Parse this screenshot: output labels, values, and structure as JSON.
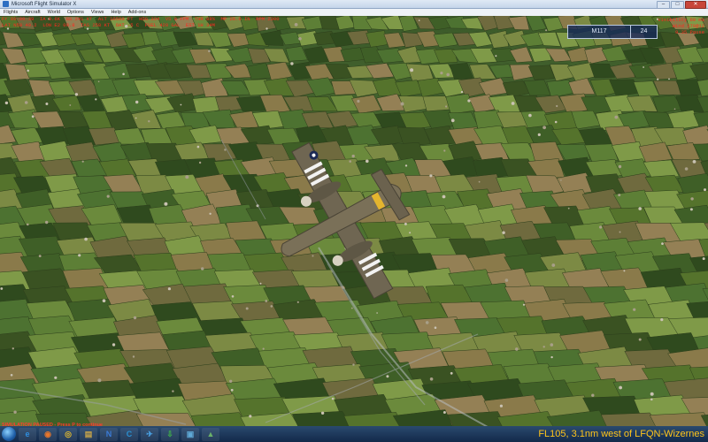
{
  "window": {
    "title": "Microsoft Flight Simulator X",
    "minimize": "–",
    "maximize": "□",
    "close": "✕"
  },
  "menu": [
    "Flights",
    "Aircraft",
    "World",
    "Options",
    "Views",
    "Help",
    "Add-ons"
  ],
  "hud": {
    "line1": "Fr 00:00:39  IA 9.6K  GS 241 KT  ALT 10500 FT  HDG 334  VS 0 FPM  THR 88%  MP 28.0 IN  RPM 2300",
    "line2": "LAT N50 49.2  LON E2 09.8  TAS 258 KT  OAT -5 C  FUEL 420 GAL  EST 1H 34M",
    "right1": "Visibility 60 mi",
    "right2": "Wind 270@12",
    "right3": "9.35 Pause"
  },
  "gps": {
    "waypoint": "M117",
    "value": "24"
  },
  "status_message": "SIMULATION PAUSED - Press P to continue",
  "flight_status": "FL105, 3.1nm west of LFQN-Wizernes",
  "taskbar": {
    "icons": [
      {
        "name": "internet-explorer-icon",
        "glyph": "e",
        "color": "#2f8fe0"
      },
      {
        "name": "firefox-icon",
        "glyph": "◉",
        "color": "#e8762b"
      },
      {
        "name": "chrome-icon",
        "glyph": "◎",
        "color": "#e0b92f"
      },
      {
        "name": "file-explorer-icon",
        "glyph": "▤",
        "color": "#c9a54a"
      },
      {
        "name": "network-icon",
        "glyph": "N",
        "color": "#3b7bd6"
      },
      {
        "name": "app-c-icon",
        "glyph": "C",
        "color": "#2a8fd0"
      },
      {
        "name": "flight-sim-icon",
        "glyph": "✈",
        "color": "#4aa3e6"
      },
      {
        "name": "download-icon",
        "glyph": "⇩",
        "color": "#3fb04a"
      },
      {
        "name": "window-icon",
        "glyph": "▣",
        "color": "#5fa9d6"
      },
      {
        "name": "landscape-icon",
        "glyph": "▲",
        "color": "#6ab06a"
      }
    ]
  }
}
